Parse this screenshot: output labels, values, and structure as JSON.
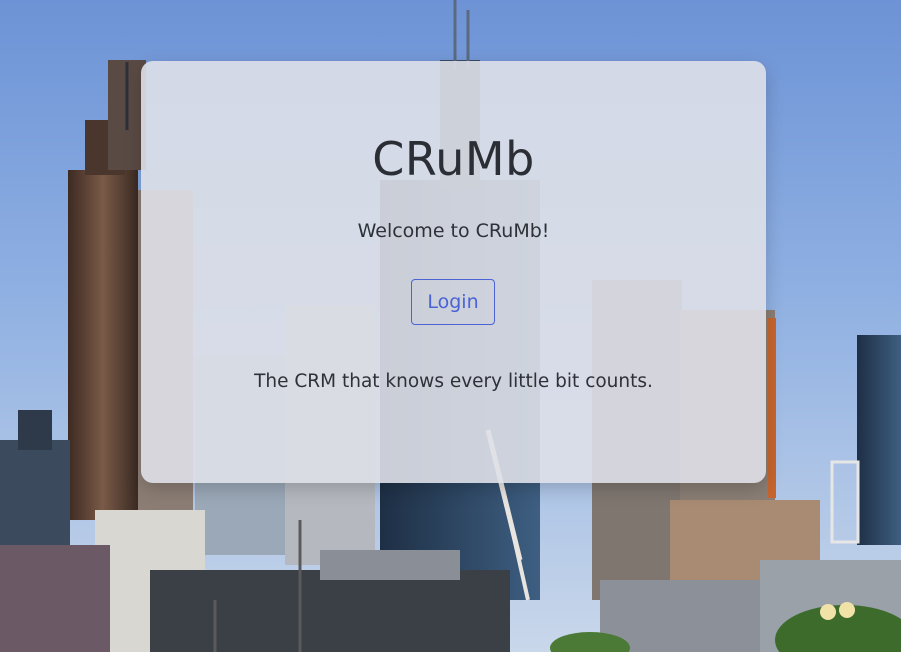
{
  "page": {
    "title": "CRuMb",
    "welcome": "Welcome to CRuMb!",
    "login_label": "Login",
    "tagline": "The CRM that knows every little bit counts."
  },
  "background": {
    "description_icon": "city-skyline-image"
  },
  "colors": {
    "accent": "#4a62d6",
    "text": "#2c2f36",
    "card": "#dee0e8"
  }
}
